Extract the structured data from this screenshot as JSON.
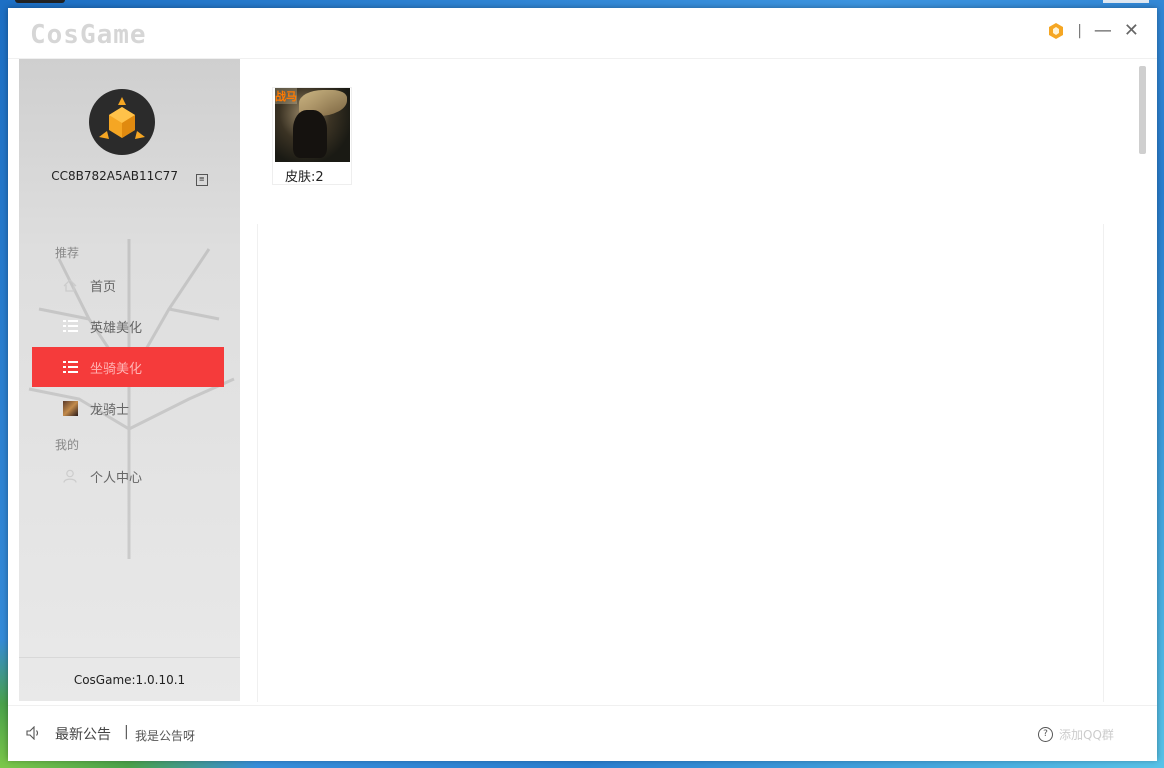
{
  "app": {
    "logo": "CosGame"
  },
  "title_controls": {
    "separator": "|",
    "minimize": "—",
    "close": "✕"
  },
  "user": {
    "id": "CC8B782A5AB11C77"
  },
  "sidebar": {
    "section_recommend": "推荐",
    "section_mine": "我的",
    "items": [
      {
        "label": "首页"
      },
      {
        "label": "英雄美化"
      },
      {
        "label": "坐骑美化",
        "active": true
      },
      {
        "label": "龙骑士"
      },
      {
        "label": "个人中心"
      }
    ],
    "version": "CosGame:1.0.10.1"
  },
  "content": {
    "card": {
      "tag": "战马",
      "label": "皮肤:2"
    }
  },
  "bottom": {
    "notice_title": "最新公告",
    "notice_sep": "|",
    "notice_text": "我是公告呀",
    "help_label": "添加QQ群"
  },
  "colors": {
    "active_nav": "#f53b3b",
    "accent_orange": "#f5a623"
  }
}
